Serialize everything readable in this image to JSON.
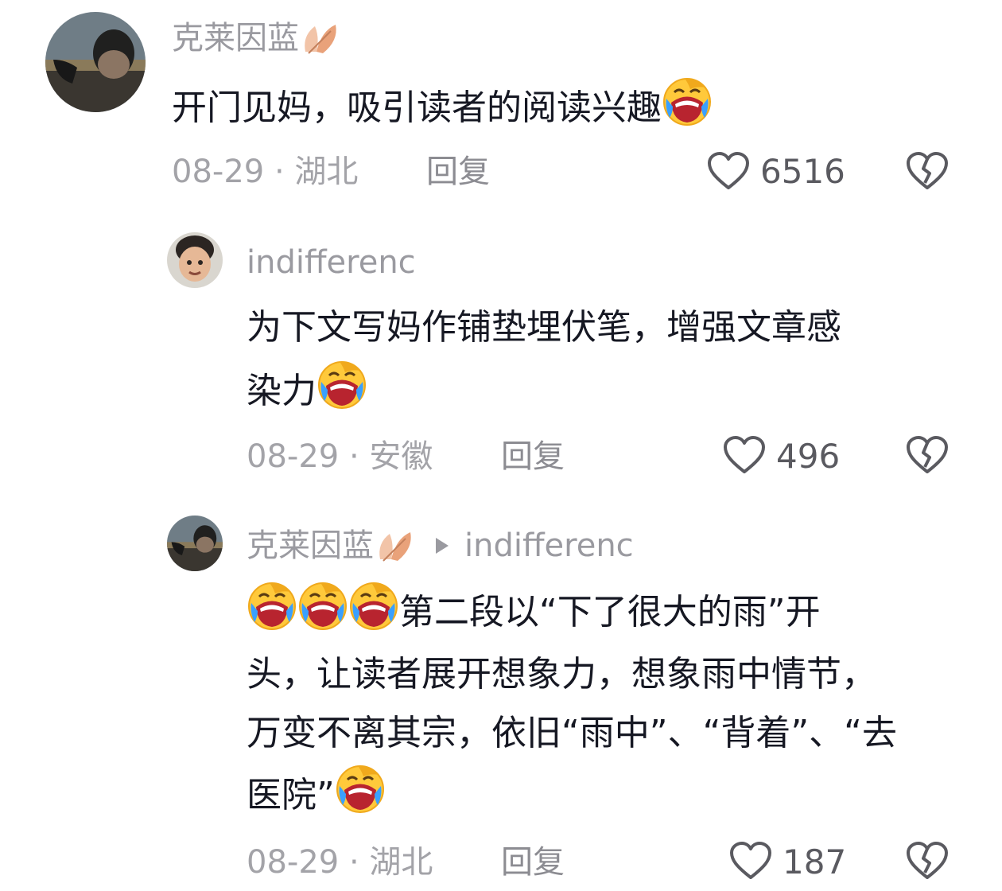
{
  "comments": [
    {
      "username": "克莱因蓝",
      "text": "开门见妈，吸引读者的阅读兴趣",
      "date": "08-29",
      "location": "湖北",
      "reply": "回复",
      "likes": "6516"
    },
    {
      "username": "indifferenc",
      "text_line1": "为下文写妈作铺垫埋伏笔，增强文章感",
      "text_line2": "染力",
      "date": "08-29",
      "location": "安徽",
      "reply": "回复",
      "likes": "496"
    },
    {
      "username": "克莱因蓝",
      "reply_to": "indifferenc",
      "text_line1": "第二段以“下了很大的雨”开",
      "text_line2": "头，让读者展开想象力，想象雨中情节，",
      "text_line3": "万变不离其宗，依旧“雨中”、“背着”、“去",
      "text_line4": "医院”",
      "date": "08-29",
      "location": "湖北",
      "reply": "回复",
      "likes": "187"
    }
  ],
  "separator": " · ",
  "icons": {
    "like": "heart-outline-icon",
    "dislike": "broken-heart-icon",
    "emoji": "laughing-crying-emoji",
    "badge": "maple-leaf-icon",
    "reply_arrow": "triangle-right-icon"
  }
}
